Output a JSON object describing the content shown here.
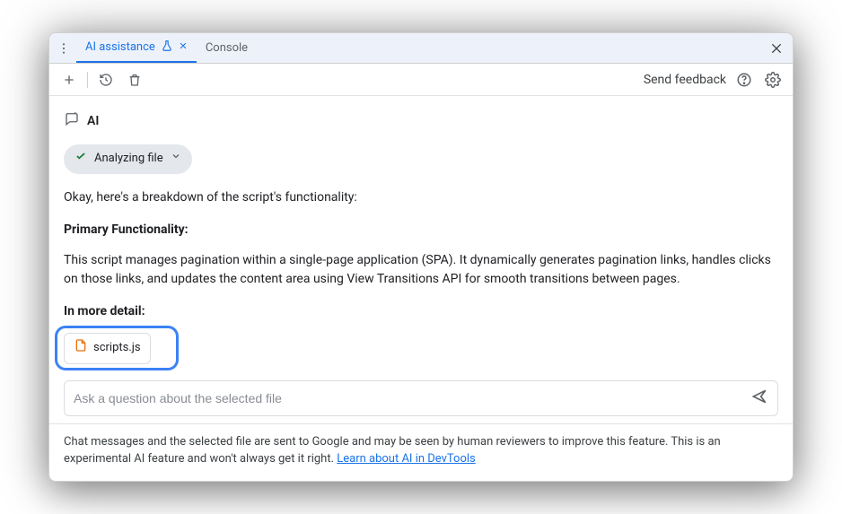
{
  "tabs": {
    "ai_label": "AI assistance",
    "console_label": "Console"
  },
  "toolbar": {
    "feedback": "Send feedback"
  },
  "ai": {
    "title": "AI",
    "status": "Analyzing file"
  },
  "body": {
    "intro": "Okay, here's a breakdown of the script's functionality:",
    "h1": "Primary Functionality:",
    "p1": "This script manages pagination within a single-page application (SPA). It dynamically generates pagination links, handles clicks on those links, and updates the content area using View Transitions API for smooth transitions between pages.",
    "h2": "In more detail:"
  },
  "file": {
    "name": "scripts.js"
  },
  "input": {
    "placeholder": "Ask a question about the selected file"
  },
  "footer": {
    "text": "Chat messages and the selected file are sent to Google and may be seen by human reviewers to improve this feature. This is an experimental AI feature and won't always get it right. ",
    "link": "Learn about AI in DevTools"
  }
}
